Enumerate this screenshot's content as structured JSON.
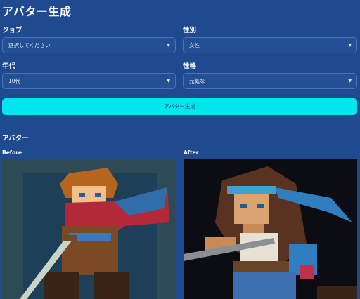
{
  "title": "アバター生成",
  "form": {
    "job": {
      "label": "ジョブ",
      "value": "選択してください"
    },
    "gender": {
      "label": "性別",
      "value": "女性"
    },
    "age": {
      "label": "年代",
      "value": "10代"
    },
    "personality": {
      "label": "性格",
      "value": "元気な"
    }
  },
  "generate_button": "アバター生成",
  "avatar_section": {
    "title": "アバター",
    "before_label": "Before",
    "after_label": "After"
  },
  "colors": {
    "background": "#1f4a8f",
    "accent": "#00e5ee"
  },
  "icons": {
    "dropdown": "chevron-down-icon"
  }
}
